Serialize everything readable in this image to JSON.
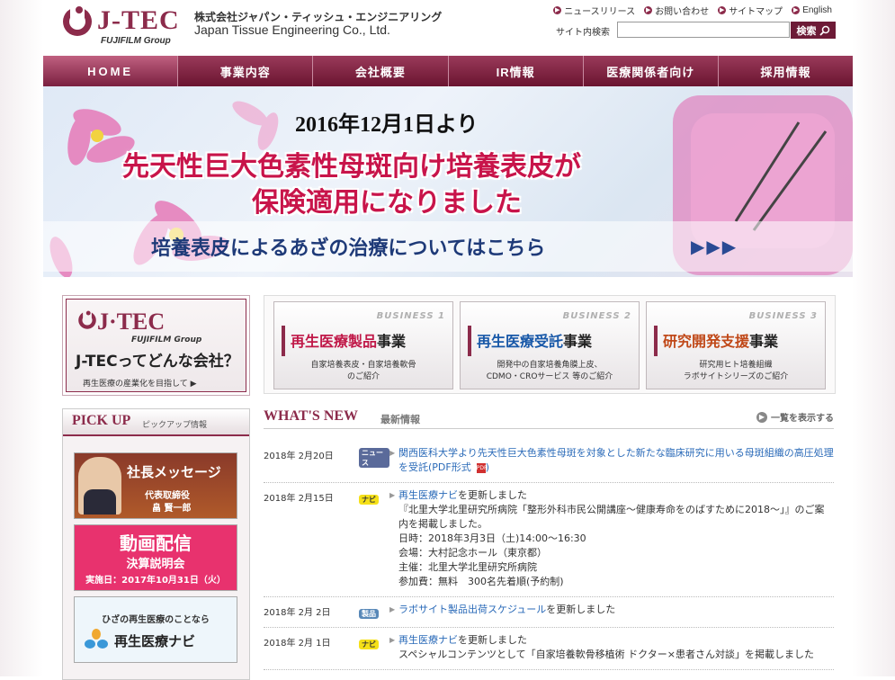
{
  "header": {
    "logo_text": "J-TEC",
    "logo_group": "FUJIFILM Group",
    "company_ja": "株式会社ジャパン・ティッシュ・エンジニアリング",
    "company_en": "Japan Tissue Engineering Co., Ltd.",
    "toplinks": [
      "ニュースリリース",
      "お問い合わせ",
      "サイトマップ",
      "English"
    ],
    "search_label": "サイト内検索",
    "search_value": "",
    "search_button": "検索"
  },
  "nav": [
    "HOME",
    "事業内容",
    "会社概要",
    "IR情報",
    "医療関係者向け",
    "採用情報"
  ],
  "hero": {
    "date": "2016年12月1日より",
    "title1": "先天性巨大色素性母斑向け培養表皮が",
    "title2": "保険適用になりました",
    "sub": "培養表皮によるあざの治療についてはこちら",
    "arrows": "▶▶▶"
  },
  "jtec_box": {
    "logo": "J·TEC",
    "group": "FUJIFILM Group",
    "question": "J-TECってどんな会社？",
    "bottom": "再生医療の産業化を目指して ▶"
  },
  "pickup": {
    "title": "PICK UP",
    "sub": "ピックアップ情報",
    "message": {
      "title": "社長メッセージ",
      "role": "代表取締役",
      "name": "畠 賢一郎"
    },
    "video": {
      "title": "動画配信",
      "sub": "決算説明会",
      "date": "実施日：2017年10月31日（火）"
    },
    "navi": {
      "top": "ひざの再生医療のことなら",
      "title": "再生医療ナビ"
    }
  },
  "business": [
    {
      "num": "BUSINESS 1",
      "hl": "再生医療製品",
      "rest": "事業",
      "desc1": "自家培養表皮・自家培養軟骨",
      "desc2": "のご紹介"
    },
    {
      "num": "BUSINESS 2",
      "hl": "再生医療受託",
      "rest": "事業",
      "desc1": "開発中の自家培養角膜上皮、",
      "desc2": "CDMO・CROサービス 等のご紹介"
    },
    {
      "num": "BUSINESS 3",
      "hl": "研究開発支援",
      "rest": "事業",
      "desc1": "研究用ヒト培養組織",
      "desc2": "ラボサイトシリーズのご紹介"
    }
  ],
  "whats_new": {
    "title": "WHAT'S NEW",
    "sub": "最新情報",
    "all": "一覧を表示する"
  },
  "news": [
    {
      "date": "2018年 2月20日",
      "tag": "ニュース",
      "link": "関西医科大学より先天性巨大色素性母斑を対象とした新たな臨床研究に用いる母斑組織の高圧処理を受託(PDF形式",
      "after": "",
      "lines": [],
      "pdf": ")"
    },
    {
      "date": "2018年 2月15日",
      "tag": "ナビ",
      "link": "再生医療ナビ",
      "after": "を更新しました",
      "lines": [
        "『北里大学北里研究所病院「整形外科市民公開講座～健康寿命をのばすために2018～」』のご案内を掲載しました。",
        "日時：2018年3月3日（土)14:00～16:30",
        "会場：大村記念ホール（東京都）",
        "主催：北里大学北里研究所病院",
        "参加費：無料　300名先着順(予約制)"
      ]
    },
    {
      "date": "2018年 2月 2日",
      "tag": "製品",
      "link": "ラボサイト製品出荷スケジュール",
      "after": "を更新しました",
      "lines": []
    },
    {
      "date": "2018年 2月 1日",
      "tag": "ナビ",
      "link": "再生医療ナビ",
      "after": "を更新しました",
      "lines": [
        "スペシャルコンテンツとして「自家培養軟骨移植術 ドクター×患者さん対談」を掲載しました"
      ]
    }
  ],
  "colors": {
    "brand": "#8c2b4b",
    "link": "#2a6ab8",
    "hero_title": "#c8144a"
  }
}
